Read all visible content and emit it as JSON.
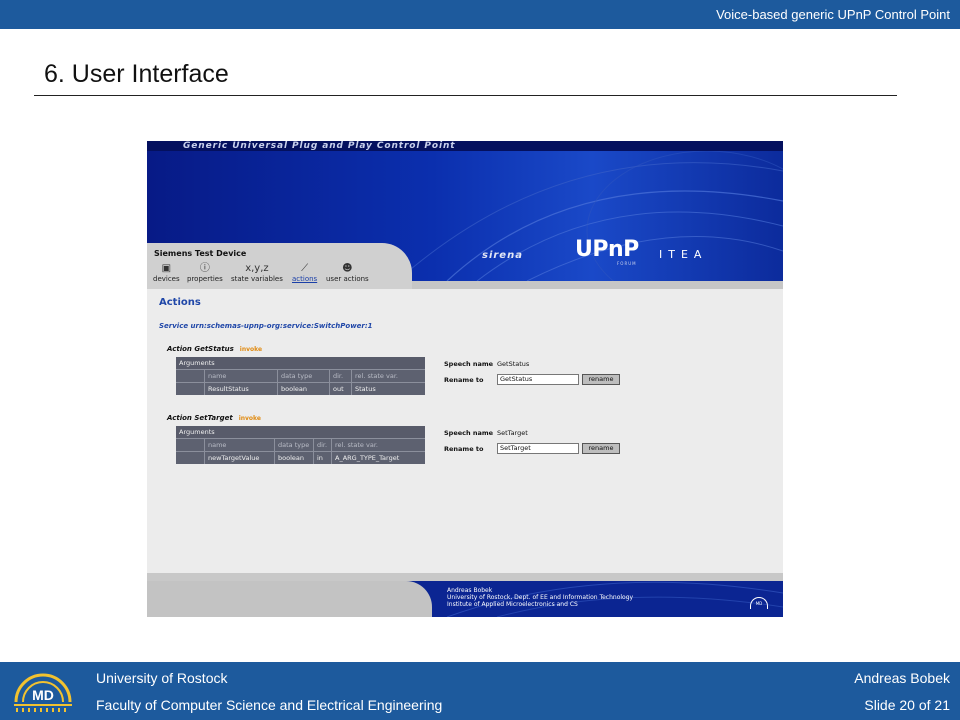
{
  "header": {
    "title": "Voice-based generic UPnP Control Point",
    "slide_title": "6. User Interface"
  },
  "app": {
    "banner": {
      "title": "Generic Universal Plug and Play Control Point",
      "sirena": "sirena",
      "upnp": "UPnP",
      "upnp_sub": "FORUM",
      "itea": "ITEA"
    },
    "device_name": "Siemens Test Device",
    "nav": [
      {
        "label": "devices",
        "icon": "device-icon",
        "glyph": "▣"
      },
      {
        "label": "properties",
        "icon": "info-icon",
        "glyph": "ⓘ"
      },
      {
        "label": "state variables",
        "icon": "variables-icon",
        "glyph": "x,y,z"
      },
      {
        "label": "actions",
        "icon": "actions-icon",
        "glyph": "⟋",
        "active": true
      },
      {
        "label": "user actions",
        "icon": "user-actions-icon",
        "glyph": "☻"
      }
    ],
    "content_title": "Actions",
    "service": "Service urn:schemas-upnp-org:service:SwitchPower:1",
    "invoke_label": "invoke",
    "arguments_label": "Arguments",
    "columns": [
      "name",
      "data type",
      "dir.",
      "rel. state var."
    ],
    "speech_name_label": "Speech name",
    "rename_to_label": "Rename to",
    "rename_button": "rename",
    "actions": [
      {
        "header": "Action GetStatus",
        "args": [
          {
            "name": "ResultStatus",
            "type": "boolean",
            "dir": "out",
            "var": "Status"
          }
        ],
        "speech_name": "GetStatus",
        "rename_value": "GetStatus"
      },
      {
        "header": "Action SetTarget",
        "args": [
          {
            "name": "newTargetValue",
            "type": "boolean",
            "dir": "in",
            "var": "A_ARG_TYPE_Target"
          }
        ],
        "speech_name": "SetTarget",
        "rename_value": "SetTarget"
      }
    ],
    "footer": {
      "line1": "Andreas Bobek",
      "line2": "University of Rostock, Dept. of EE and Information Technology",
      "line3": "Institute of Applied Microelectronics and CS",
      "logo": "MD"
    }
  },
  "bottom": {
    "university": "University of Rostock",
    "faculty": "Faculty of Computer Science and Electrical Engineering",
    "author": "Andreas Bobek",
    "slide": "Slide 20 of 21",
    "logo": "MD"
  },
  "colors": {
    "bar_blue": "#1d5a9d",
    "banner_blue": "#0b2fae",
    "link_blue": "#2047a8",
    "invoke_orange": "#e08a10"
  }
}
